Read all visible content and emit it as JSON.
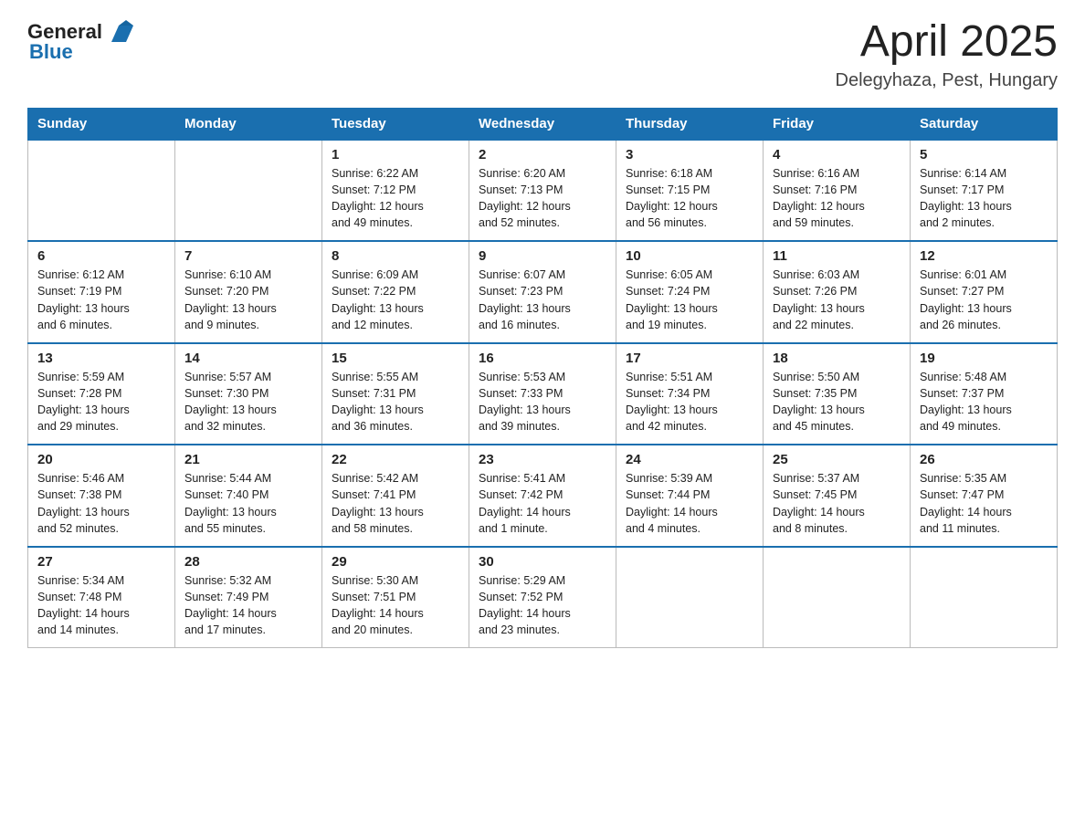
{
  "header": {
    "logo_general": "General",
    "logo_blue": "Blue",
    "month_title": "April 2025",
    "location": "Delegyhaza, Pest, Hungary"
  },
  "weekdays": [
    "Sunday",
    "Monday",
    "Tuesday",
    "Wednesday",
    "Thursday",
    "Friday",
    "Saturday"
  ],
  "weeks": [
    [
      {
        "day": "",
        "info": ""
      },
      {
        "day": "",
        "info": ""
      },
      {
        "day": "1",
        "info": "Sunrise: 6:22 AM\nSunset: 7:12 PM\nDaylight: 12 hours\nand 49 minutes."
      },
      {
        "day": "2",
        "info": "Sunrise: 6:20 AM\nSunset: 7:13 PM\nDaylight: 12 hours\nand 52 minutes."
      },
      {
        "day": "3",
        "info": "Sunrise: 6:18 AM\nSunset: 7:15 PM\nDaylight: 12 hours\nand 56 minutes."
      },
      {
        "day": "4",
        "info": "Sunrise: 6:16 AM\nSunset: 7:16 PM\nDaylight: 12 hours\nand 59 minutes."
      },
      {
        "day": "5",
        "info": "Sunrise: 6:14 AM\nSunset: 7:17 PM\nDaylight: 13 hours\nand 2 minutes."
      }
    ],
    [
      {
        "day": "6",
        "info": "Sunrise: 6:12 AM\nSunset: 7:19 PM\nDaylight: 13 hours\nand 6 minutes."
      },
      {
        "day": "7",
        "info": "Sunrise: 6:10 AM\nSunset: 7:20 PM\nDaylight: 13 hours\nand 9 minutes."
      },
      {
        "day": "8",
        "info": "Sunrise: 6:09 AM\nSunset: 7:22 PM\nDaylight: 13 hours\nand 12 minutes."
      },
      {
        "day": "9",
        "info": "Sunrise: 6:07 AM\nSunset: 7:23 PM\nDaylight: 13 hours\nand 16 minutes."
      },
      {
        "day": "10",
        "info": "Sunrise: 6:05 AM\nSunset: 7:24 PM\nDaylight: 13 hours\nand 19 minutes."
      },
      {
        "day": "11",
        "info": "Sunrise: 6:03 AM\nSunset: 7:26 PM\nDaylight: 13 hours\nand 22 minutes."
      },
      {
        "day": "12",
        "info": "Sunrise: 6:01 AM\nSunset: 7:27 PM\nDaylight: 13 hours\nand 26 minutes."
      }
    ],
    [
      {
        "day": "13",
        "info": "Sunrise: 5:59 AM\nSunset: 7:28 PM\nDaylight: 13 hours\nand 29 minutes."
      },
      {
        "day": "14",
        "info": "Sunrise: 5:57 AM\nSunset: 7:30 PM\nDaylight: 13 hours\nand 32 minutes."
      },
      {
        "day": "15",
        "info": "Sunrise: 5:55 AM\nSunset: 7:31 PM\nDaylight: 13 hours\nand 36 minutes."
      },
      {
        "day": "16",
        "info": "Sunrise: 5:53 AM\nSunset: 7:33 PM\nDaylight: 13 hours\nand 39 minutes."
      },
      {
        "day": "17",
        "info": "Sunrise: 5:51 AM\nSunset: 7:34 PM\nDaylight: 13 hours\nand 42 minutes."
      },
      {
        "day": "18",
        "info": "Sunrise: 5:50 AM\nSunset: 7:35 PM\nDaylight: 13 hours\nand 45 minutes."
      },
      {
        "day": "19",
        "info": "Sunrise: 5:48 AM\nSunset: 7:37 PM\nDaylight: 13 hours\nand 49 minutes."
      }
    ],
    [
      {
        "day": "20",
        "info": "Sunrise: 5:46 AM\nSunset: 7:38 PM\nDaylight: 13 hours\nand 52 minutes."
      },
      {
        "day": "21",
        "info": "Sunrise: 5:44 AM\nSunset: 7:40 PM\nDaylight: 13 hours\nand 55 minutes."
      },
      {
        "day": "22",
        "info": "Sunrise: 5:42 AM\nSunset: 7:41 PM\nDaylight: 13 hours\nand 58 minutes."
      },
      {
        "day": "23",
        "info": "Sunrise: 5:41 AM\nSunset: 7:42 PM\nDaylight: 14 hours\nand 1 minute."
      },
      {
        "day": "24",
        "info": "Sunrise: 5:39 AM\nSunset: 7:44 PM\nDaylight: 14 hours\nand 4 minutes."
      },
      {
        "day": "25",
        "info": "Sunrise: 5:37 AM\nSunset: 7:45 PM\nDaylight: 14 hours\nand 8 minutes."
      },
      {
        "day": "26",
        "info": "Sunrise: 5:35 AM\nSunset: 7:47 PM\nDaylight: 14 hours\nand 11 minutes."
      }
    ],
    [
      {
        "day": "27",
        "info": "Sunrise: 5:34 AM\nSunset: 7:48 PM\nDaylight: 14 hours\nand 14 minutes."
      },
      {
        "day": "28",
        "info": "Sunrise: 5:32 AM\nSunset: 7:49 PM\nDaylight: 14 hours\nand 17 minutes."
      },
      {
        "day": "29",
        "info": "Sunrise: 5:30 AM\nSunset: 7:51 PM\nDaylight: 14 hours\nand 20 minutes."
      },
      {
        "day": "30",
        "info": "Sunrise: 5:29 AM\nSunset: 7:52 PM\nDaylight: 14 hours\nand 23 minutes."
      },
      {
        "day": "",
        "info": ""
      },
      {
        "day": "",
        "info": ""
      },
      {
        "day": "",
        "info": ""
      }
    ]
  ]
}
